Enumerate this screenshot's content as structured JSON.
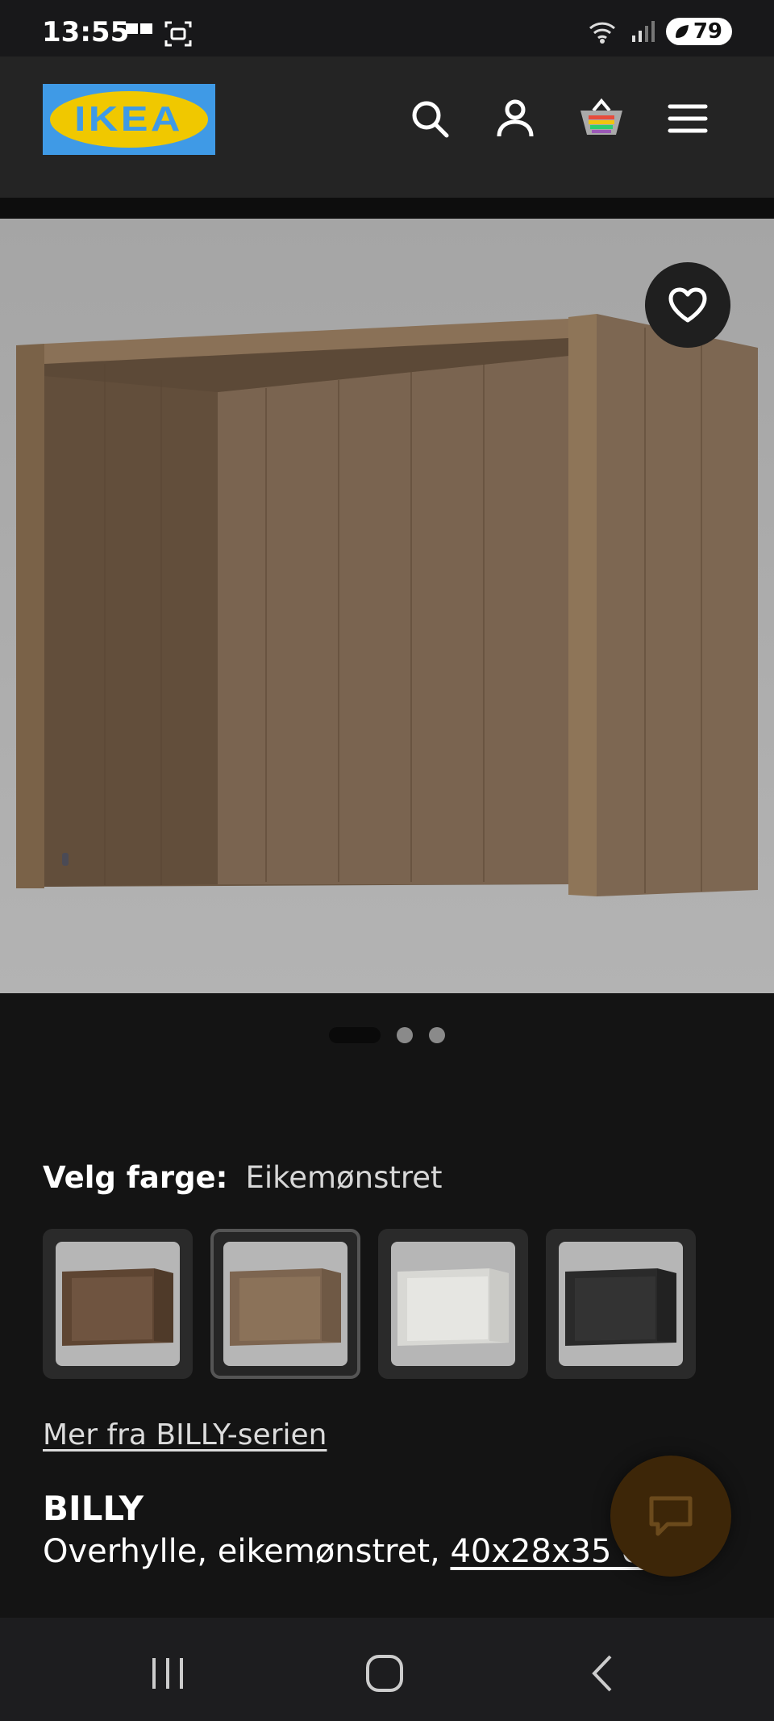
{
  "status_bar": {
    "time": "13:55",
    "battery": "79"
  },
  "header": {
    "logo_text": "IKEA",
    "icons": [
      "search-icon",
      "account-icon",
      "cart-icon",
      "menu-icon"
    ]
  },
  "gallery": {
    "image_count": 3,
    "active_index": 0
  },
  "color_select": {
    "label": "Velg farge:",
    "value": "Eikemønstret",
    "swatches": [
      "walnut-brown",
      "oak-effect",
      "white",
      "black-brown"
    ],
    "selected_index": 1
  },
  "series_link": "Mer fra BILLY-serien",
  "product": {
    "name": "BILLY",
    "desc_prefix": "Overhylle, eikemønstret, ",
    "size": "40x28x35 cm"
  },
  "colors": {
    "background": "#141414",
    "header": "#242424",
    "ikea_blue": "#3f9ae6",
    "ikea_yellow": "#f0c800",
    "chat_bubble": "#3d2608"
  }
}
